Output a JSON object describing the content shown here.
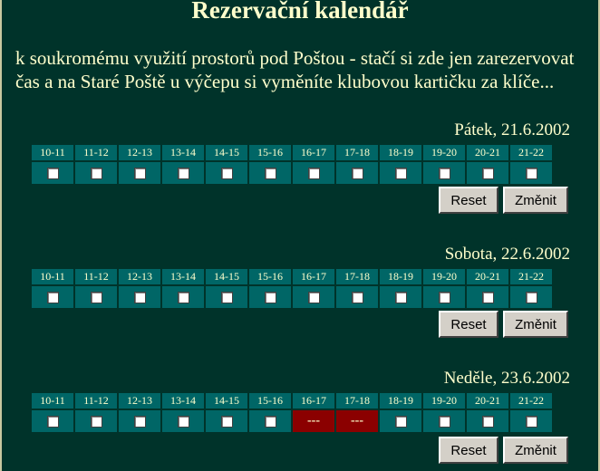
{
  "page": {
    "title": "Rezervační kalendář",
    "intro": "k soukromému využití prostorů pod Poštou - stačí si zde jen zarezervovat čas a na Staré Poště u výčepu si vyměníte klubovou kartičku za klíče..."
  },
  "hours": [
    "10-11",
    "11-12",
    "12-13",
    "13-14",
    "14-15",
    "15-16",
    "16-17",
    "17-18",
    "18-19",
    "19-20",
    "20-21",
    "21-22"
  ],
  "days": [
    {
      "date": "Pátek, 21.6.2002",
      "reset_label": "Reset",
      "submit_label": "Změnit",
      "slots": [
        "free",
        "free",
        "free",
        "free",
        "free",
        "free",
        "free",
        "free",
        "free",
        "free",
        "free",
        "free"
      ]
    },
    {
      "date": "Sobota, 22.6.2002",
      "reset_label": "Reset",
      "submit_label": "Změnit",
      "slots": [
        "free",
        "free",
        "free",
        "free",
        "free",
        "free",
        "free",
        "free",
        "free",
        "free",
        "free",
        "free"
      ]
    },
    {
      "date": "Neděle, 23.6.2002",
      "reset_label": "Reset",
      "submit_label": "Změnit",
      "slots": [
        "free",
        "free",
        "free",
        "free",
        "free",
        "free",
        "---",
        "---",
        "free",
        "free",
        "free",
        "free"
      ]
    }
  ],
  "colors": {
    "background": "#00332a",
    "cell": "#006666",
    "taken": "#8b0000",
    "text": "#ffffcc"
  }
}
